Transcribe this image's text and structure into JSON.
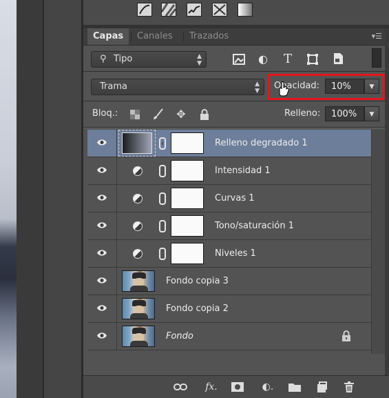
{
  "tabs": [
    {
      "label": "Capas",
      "active": true
    },
    {
      "label": "Canales",
      "active": false
    },
    {
      "label": "Trazados",
      "active": false
    }
  ],
  "filter": {
    "kind_label": "Tipo",
    "icons": [
      "image-filter-icon",
      "adjustment-filter-icon",
      "type-filter-icon",
      "shape-filter-icon",
      "smart-object-filter-icon"
    ]
  },
  "blend_mode": "Trama",
  "opacity": {
    "label": "Opacidad:",
    "value": "10%"
  },
  "lock": {
    "label": "Bloq.:"
  },
  "fill": {
    "label": "Relleno:",
    "value": "100%"
  },
  "layers": [
    {
      "name": "Relleno degradado 1",
      "type": "gradient-fill",
      "selected": true
    },
    {
      "name": "Intensidad 1",
      "type": "adjustment",
      "selected": false
    },
    {
      "name": "Curvas 1",
      "type": "adjustment",
      "selected": false
    },
    {
      "name": "Tono/saturación 1",
      "type": "adjustment",
      "selected": false
    },
    {
      "name": "Niveles 1",
      "type": "adjustment",
      "selected": false
    },
    {
      "name": "Fondo copia 3",
      "type": "image",
      "selected": false
    },
    {
      "name": "Fondo copia 2",
      "type": "image",
      "selected": false
    },
    {
      "name": "Fondo",
      "type": "image",
      "selected": false,
      "italic": true,
      "locked": true
    }
  ],
  "accent_colors": {
    "selection": "#6d7e9a",
    "highlight_box": "#e8141c"
  }
}
